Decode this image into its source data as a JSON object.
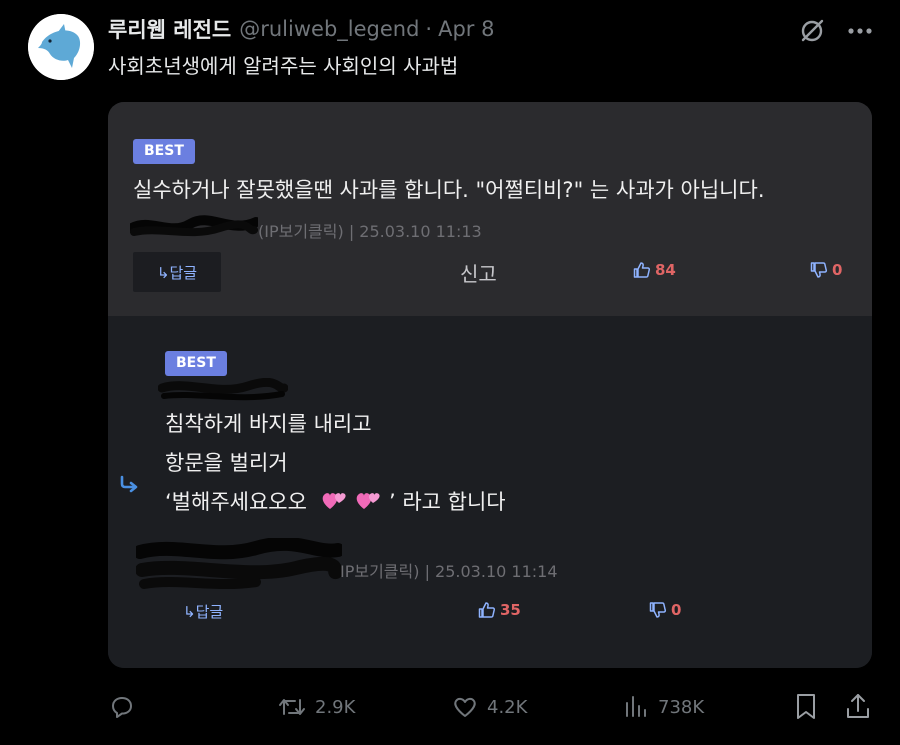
{
  "tweet": {
    "author": "루리웹 레전드",
    "handle": "@ruliweb_legend",
    "separator": "·",
    "date": "Apr 8",
    "text": "사회초년생에게 알려주는 사회인의 사과법"
  },
  "comments": [
    {
      "badge": "BEST",
      "text": "실수하거나 잘못했을땐 사과를 합니다. \"어쩔티비?\" 는 사과가 아닙니다.",
      "meta": "(IP보기클릭) | 25.03.10 11:13",
      "reply_label": "↳답글",
      "report_label": "신고",
      "upvotes": "84",
      "downvotes": "0"
    },
    {
      "badge": "BEST",
      "lines": [
        "침착하게 바지를 내리고",
        "항문을 벌리거",
        "‘벌해주세요오오",
        "’ 라고 합니다"
      ],
      "meta": "IP보기클릭) | 25.03.10 11:14",
      "reply_label": "↳답글",
      "upvotes": "35",
      "downvotes": "0"
    }
  ],
  "actions": {
    "reply_count": "",
    "retweets": "2.9K",
    "likes": "4.2K",
    "views": "738K"
  },
  "colors": {
    "background": "#000000",
    "badge": "#6b7fe0",
    "vote": "#e06565",
    "reply_link": "#8fb3ff"
  }
}
